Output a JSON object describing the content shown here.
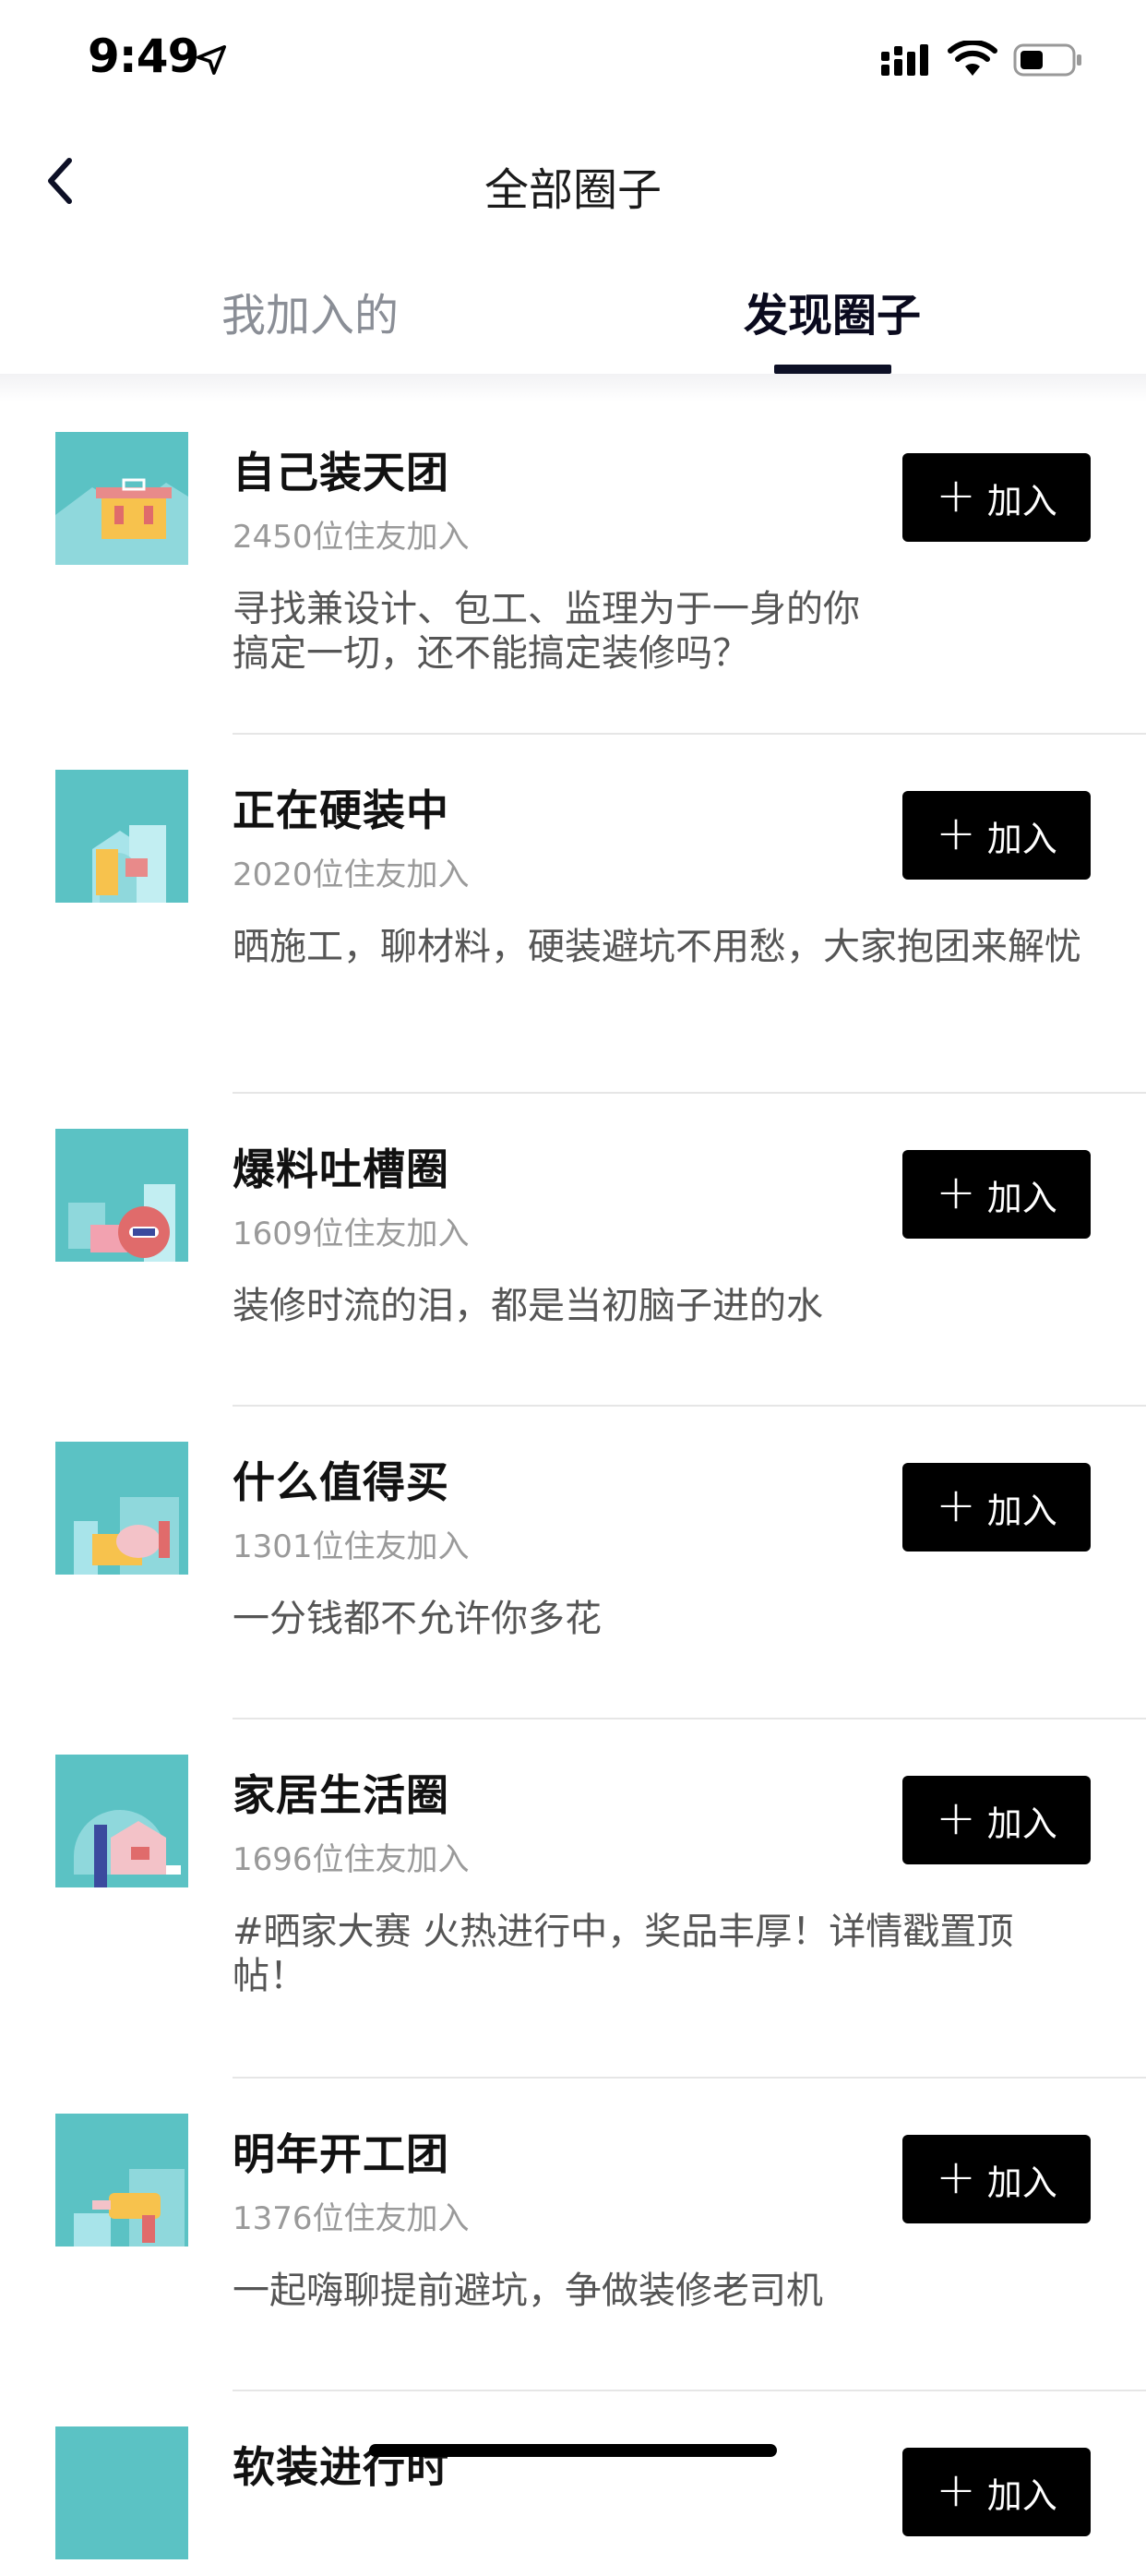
{
  "status_bar": {
    "time": "9:49",
    "icons": [
      "location-arrow-icon",
      "signal-icon",
      "wifi-icon",
      "battery-icon"
    ]
  },
  "nav": {
    "title": "全部圈子",
    "back_icon": "chevron-left-icon"
  },
  "tabs": [
    {
      "label": "我加入的",
      "active": false
    },
    {
      "label": "发现圈子",
      "active": true
    }
  ],
  "join_label": "加入",
  "join_icon": "plus-icon",
  "circles": [
    {
      "name": "自己装天团",
      "members": "2450位住友加入",
      "desc": "寻找兼设计、包工、监理为于一身的你\n搞定一切，还不能搞定装修吗？"
    },
    {
      "name": "正在硬装中",
      "members": "2020位住友加入",
      "desc": "晒施工，聊材料，硬装避坑不用愁，大家抱团来解忧"
    },
    {
      "name": "爆料吐槽圈",
      "members": "1609位住友加入",
      "desc": "装修时流的泪，都是当初脑子进的水"
    },
    {
      "name": "什么值得买",
      "members": "1301位住友加入",
      "desc": "一分钱都不允许你多花"
    },
    {
      "name": "家居生活圈",
      "members": "1696位住友加入",
      "desc": "#晒家大赛 火热进行中，奖品丰厚！详情戳置顶帖！"
    },
    {
      "name": "明年开工团",
      "members": "1376位住友加入",
      "desc": "一起嗨聊提前避坑，争做装修老司机"
    },
    {
      "name": "软装进行时",
      "members": "",
      "desc": ""
    }
  ],
  "colors": {
    "thumb_bg": "#5bc2c4",
    "button_bg": "#000000",
    "active_tab": "#0a0a1e",
    "inactive_tab": "#8a8e96"
  }
}
